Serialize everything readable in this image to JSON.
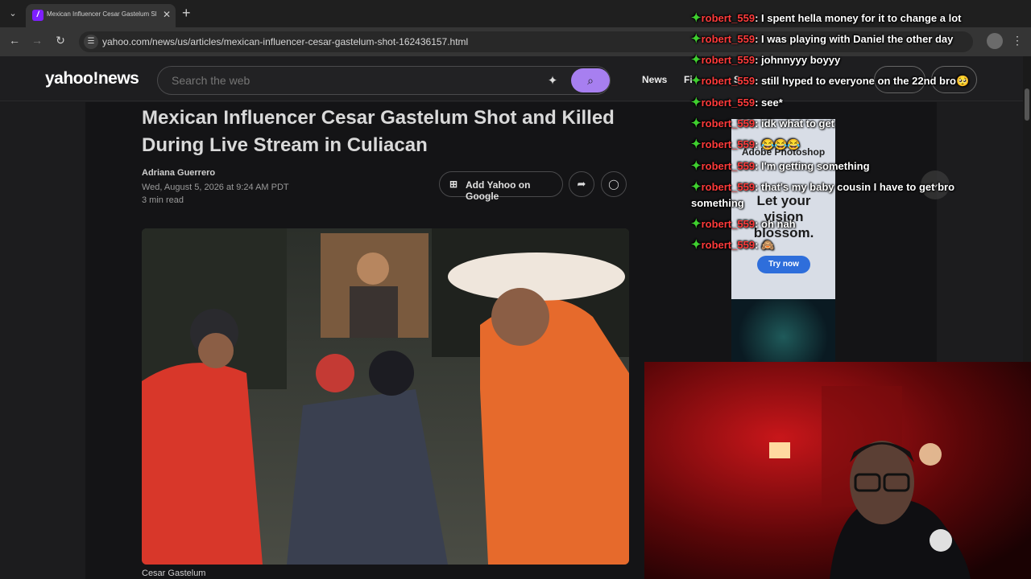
{
  "browser": {
    "tab_title": "Mexican Influencer Cesar Gastelum Shot and Killed D...",
    "url": "yahoo.com/news/us/articles/mexican-influencer-cesar-gastelum-shot-162436157.html"
  },
  "yahoo": {
    "logo": "yahoo!news",
    "search_placeholder": "Search the web",
    "nav": [
      "News",
      "Fi",
      "S"
    ]
  },
  "article": {
    "headline": "Mexican Influencer Cesar Gastelum Shot and Killed During Live Stream in Culiacan",
    "author": "Adriana Guerrero",
    "date": "Wed, August 5, 2026 at 9:24 AM PDT",
    "read_time": "3 min read",
    "add_google_label": "Add Yahoo on Google",
    "caption": "Cesar Gastelum"
  },
  "ad": {
    "brand": "Adobe Photoshop",
    "slogan": "Let your vision blossom.",
    "cta": "Try now"
  },
  "chat": {
    "messages": [
      {
        "user": "robert_559",
        "text": "I spent hella money for it to change a lot"
      },
      {
        "user": "robert_559",
        "text": "I was playing with Daniel the other day"
      },
      {
        "user": "robert_559",
        "text": "johnnyyy boyyy"
      },
      {
        "user": "robert_559",
        "text": "still hyped to everyone on the 22nd bro🥺"
      },
      {
        "user": "robert_559",
        "text": "see*"
      },
      {
        "user": "robert_559",
        "text": "idk what to get"
      },
      {
        "user": "robert_559",
        "text": "😂😂😂"
      },
      {
        "user": "robert_559",
        "text": "I'm getting something"
      },
      {
        "user": "robert_559",
        "text": "that's my baby cousin I have to get bro something"
      },
      {
        "user": "robert_559",
        "text": "oh nah"
      },
      {
        "user": "robert_559",
        "text": "🙈"
      }
    ]
  },
  "colors": {
    "accent": "#a77ff0",
    "chat_user": "#ff3b3b",
    "chat_badge": "#3fcf2f"
  }
}
